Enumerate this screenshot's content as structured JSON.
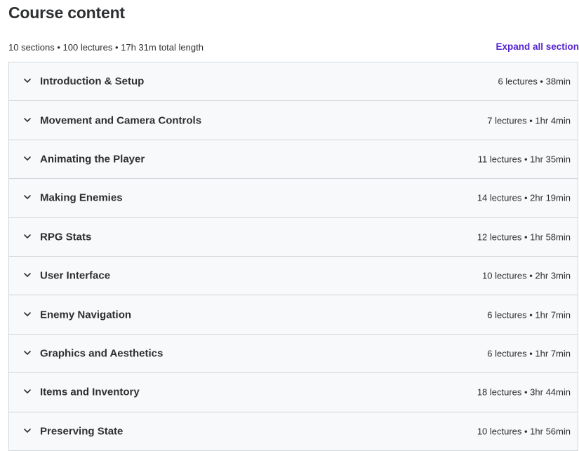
{
  "header": {
    "title": "Course content"
  },
  "summary": {
    "text": "10 sections • 100 lectures • 17h 31m total length",
    "expand_label": "Expand all section"
  },
  "colors": {
    "accent": "#5624d0",
    "row_background": "#f7f9fa",
    "border": "#d1d7dc",
    "text": "#2d2f31"
  },
  "sections": [
    {
      "title": "Introduction & Setup",
      "meta": "6 lectures • 38min",
      "icon": "chevron-down-icon"
    },
    {
      "title": "Movement and Camera Controls",
      "meta": "7 lectures • 1hr 4min",
      "icon": "chevron-down-icon"
    },
    {
      "title": "Animating the Player",
      "meta": "11 lectures • 1hr 35min",
      "icon": "chevron-down-icon"
    },
    {
      "title": "Making Enemies",
      "meta": "14 lectures • 2hr 19min",
      "icon": "chevron-down-icon"
    },
    {
      "title": "RPG Stats",
      "meta": "12 lectures • 1hr 58min",
      "icon": "chevron-down-icon"
    },
    {
      "title": "User Interface",
      "meta": "10 lectures • 2hr 3min",
      "icon": "chevron-down-icon"
    },
    {
      "title": "Enemy Navigation",
      "meta": "6 lectures • 1hr 7min",
      "icon": "chevron-down-icon"
    },
    {
      "title": "Graphics and Aesthetics",
      "meta": "6 lectures • 1hr 7min",
      "icon": "chevron-down-icon"
    },
    {
      "title": "Items and Inventory",
      "meta": "18 lectures • 3hr 44min",
      "icon": "chevron-down-icon"
    },
    {
      "title": "Preserving State",
      "meta": "10 lectures • 1hr 56min",
      "icon": "chevron-down-icon"
    }
  ]
}
